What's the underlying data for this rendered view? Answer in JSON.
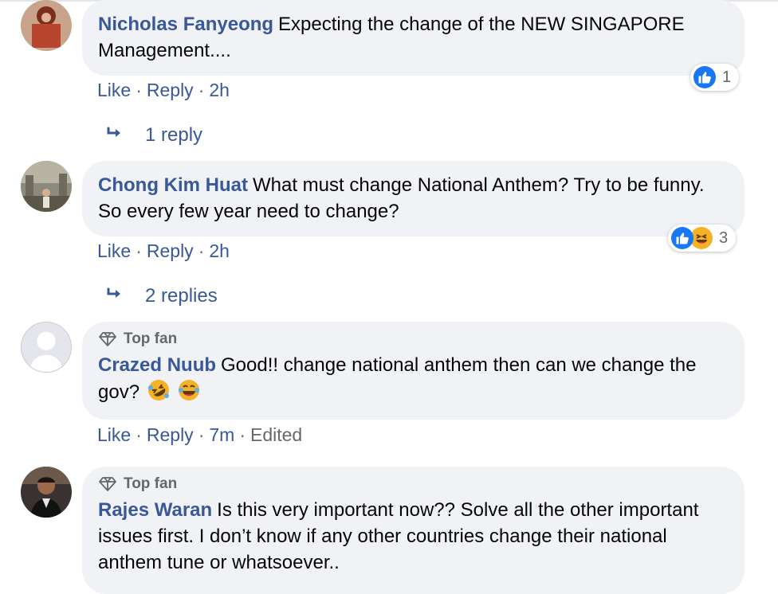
{
  "comments": [
    {
      "author": "Nicholas Fanyeong",
      "text": "Expecting the change of the NEW SINGAPORE Management....",
      "like": "Like",
      "reply": "Reply",
      "time": "2h",
      "reaction_count": "1",
      "replies_label": "1 reply"
    },
    {
      "author": "Chong Kim Huat",
      "text": "What must change National Anthem? Try to be funny. So every few year need to change?",
      "like": "Like",
      "reply": "Reply",
      "time": "2h",
      "reaction_count": "3",
      "replies_label": "2 replies"
    },
    {
      "badge": "Top fan",
      "author": "Crazed Nuub",
      "text": "Good!! change national anthem then can we change the gov?",
      "like": "Like",
      "reply": "Reply",
      "time": "7m",
      "edited": "Edited"
    },
    {
      "badge": "Top fan",
      "author": "Rajes Waran",
      "text": "Is this very important now?? Solve all the other important issues first. I don’t know if any other countries change their national anthem tune or whatsoever.."
    }
  ],
  "colors": {
    "link": "#385898",
    "muted": "#65676b",
    "bubble": "#f0f2f5",
    "like_blue": "#1877f2",
    "haha_yellow": "#f7b125"
  },
  "icons": [
    "thumbs-up-icon",
    "haha-icon",
    "reply-arrow-icon",
    "diamond-icon",
    "rofl-emoji",
    "laughing-emoji"
  ]
}
